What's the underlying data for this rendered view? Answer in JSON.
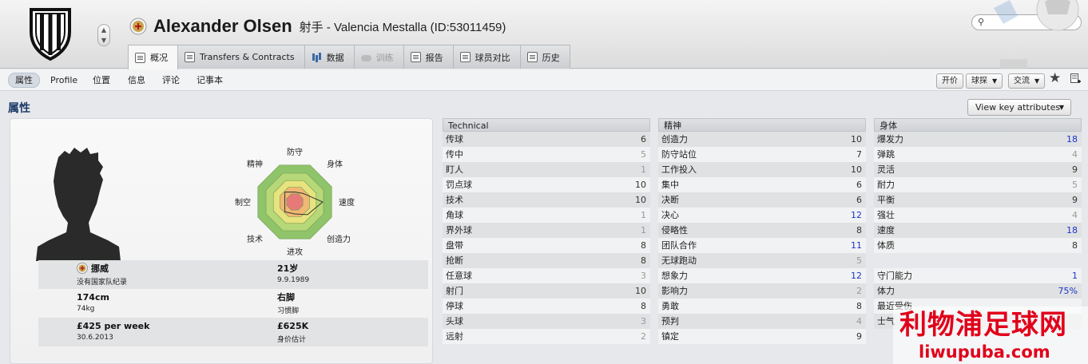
{
  "header": {
    "player_name": "Alexander Olsen",
    "subtitle": "射手 - Valencia Mestalla (ID:53011459)",
    "search_placeholder": ""
  },
  "tabs": [
    {
      "label": "概况",
      "icon": "overview-card-icon",
      "active": true
    },
    {
      "label": "Transfers & Contracts",
      "icon": "contract-document-icon"
    },
    {
      "label": "数据",
      "icon": "bar-chart-icon"
    },
    {
      "label": "训练",
      "icon": "cloud-icon",
      "disabled": true
    },
    {
      "label": "报告",
      "icon": "report-document-icon"
    },
    {
      "label": "球员对比",
      "icon": "compare-icon"
    },
    {
      "label": "历史",
      "icon": "history-document-icon"
    }
  ],
  "subnav": [
    "属性",
    "Profile",
    "位置",
    "信息",
    "评论",
    "记事本"
  ],
  "subnav_active": "属性",
  "toolbar": {
    "bid_label": "开价",
    "scout_label": "球探",
    "interact_label": "交流"
  },
  "section_title": "属性",
  "view_key_label": "View key attributes",
  "radar_labels": {
    "top": "防守",
    "top_right": "身体",
    "right": "速度",
    "bottom_right": "创造力",
    "bottom": "进攻",
    "bottom_left": "技术",
    "left": "制空",
    "top_left": "精神"
  },
  "radar_values": [
    0.25,
    0.3,
    0.7,
    0.45,
    0.3,
    0.35,
    0.25,
    0.35
  ],
  "info": {
    "nation": "挪威",
    "nation_note": "没有国家队纪录",
    "age": "21岁",
    "dob": "9.9.1989",
    "height": "174cm",
    "weight": "74kg",
    "foot": "右脚",
    "foot_label": "习惯脚",
    "wage": "£425 per week",
    "contract_end": "30.6.2013",
    "value": "£625K",
    "value_label": "身价估计"
  },
  "technical": {
    "title": "Technical",
    "rows": [
      {
        "name": "传球",
        "value": "6"
      },
      {
        "name": "传中",
        "value": "5",
        "tone": "lo"
      },
      {
        "name": "盯人",
        "value": "1",
        "tone": "lo"
      },
      {
        "name": "罚点球",
        "value": "10"
      },
      {
        "name": "技术",
        "value": "10"
      },
      {
        "name": "角球",
        "value": "1",
        "tone": "lo"
      },
      {
        "name": "界外球",
        "value": "1",
        "tone": "lo"
      },
      {
        "name": "盘带",
        "value": "8"
      },
      {
        "name": "抢断",
        "value": "8"
      },
      {
        "name": "任意球",
        "value": "3",
        "tone": "lo"
      },
      {
        "name": "射门",
        "value": "10"
      },
      {
        "name": "停球",
        "value": "8"
      },
      {
        "name": "头球",
        "value": "3",
        "tone": "lo"
      },
      {
        "name": "远射",
        "value": "2",
        "tone": "lo"
      }
    ]
  },
  "mental": {
    "title": "精神",
    "rows": [
      {
        "name": "创造力",
        "value": "10"
      },
      {
        "name": "防守站位",
        "value": "7"
      },
      {
        "name": "工作投入",
        "value": "10"
      },
      {
        "name": "集中",
        "value": "6"
      },
      {
        "name": "决断",
        "value": "6"
      },
      {
        "name": "决心",
        "value": "12",
        "tone": "hi"
      },
      {
        "name": "侵略性",
        "value": "8"
      },
      {
        "name": "团队合作",
        "value": "11",
        "tone": "hi"
      },
      {
        "name": "无球跑动",
        "value": "5",
        "tone": "lo"
      },
      {
        "name": "想象力",
        "value": "12",
        "tone": "hi"
      },
      {
        "name": "影响力",
        "value": "2",
        "tone": "lo"
      },
      {
        "name": "勇敢",
        "value": "8"
      },
      {
        "name": "预判",
        "value": "4",
        "tone": "lo"
      },
      {
        "name": "镇定",
        "value": "9"
      }
    ]
  },
  "physical": {
    "title": "身体",
    "rows": [
      {
        "name": "爆发力",
        "value": "18",
        "tone": "hi"
      },
      {
        "name": "弹跳",
        "value": "4",
        "tone": "lo"
      },
      {
        "name": "灵活",
        "value": "9"
      },
      {
        "name": "耐力",
        "value": "5",
        "tone": "lo"
      },
      {
        "name": "平衡",
        "value": "9"
      },
      {
        "name": "强壮",
        "value": "4",
        "tone": "lo"
      },
      {
        "name": "速度",
        "value": "18",
        "tone": "hi"
      },
      {
        "name": "体质",
        "value": "8"
      }
    ],
    "extra_rows": [
      {
        "name": "守门能力",
        "value": "1",
        "tone": "blue"
      },
      {
        "name": "体力",
        "value": "75%",
        "tone": "blue"
      },
      {
        "name": "最近受伤",
        "value": ""
      },
      {
        "name": "士气",
        "value": ""
      }
    ]
  },
  "watermark": {
    "main": "利物浦足球网",
    "url": "liwupuba.com"
  },
  "colors": {
    "link_blue": "#1c34c8",
    "section_title": "#1b3a66",
    "watermark_red": "#e1001a"
  }
}
